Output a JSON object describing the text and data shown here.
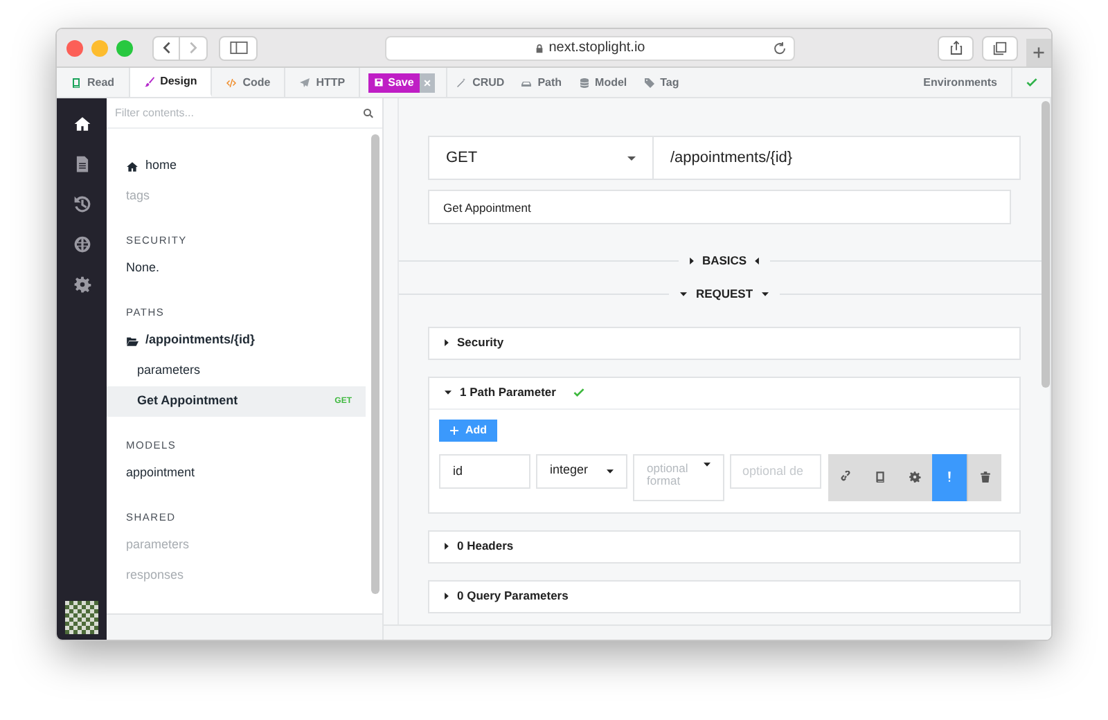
{
  "browser": {
    "url": "next.stoplight.io"
  },
  "toolbar": {
    "tabs": [
      {
        "label": "Read",
        "selected": false
      },
      {
        "label": "Design",
        "selected": true
      },
      {
        "label": "Code",
        "selected": false
      },
      {
        "label": "HTTP",
        "selected": false
      }
    ],
    "save": {
      "label": "Save",
      "close": "×"
    },
    "tools": [
      {
        "label": "CRUD"
      },
      {
        "label": "Path"
      },
      {
        "label": "Model"
      },
      {
        "label": "Tag"
      }
    ],
    "environments": "Environments"
  },
  "rail": [
    {
      "selected": true
    },
    {
      "selected": false
    },
    {
      "selected": false
    },
    {
      "selected": false
    },
    {
      "selected": false
    }
  ],
  "sidebar": {
    "filter": {
      "placeholder": "Filter contents..."
    },
    "sections": [
      {
        "items": [
          {
            "label": "home",
            "kind": "home",
            "muted": false,
            "selected": false
          },
          {
            "label": "tags",
            "muted": true,
            "selected": false
          }
        ]
      },
      {
        "heading": "SECURITY",
        "items": [
          {
            "label": "None.",
            "muted": false,
            "selected": false
          }
        ]
      },
      {
        "heading": "PATHS",
        "items": [
          {
            "label": "/appointments/{id}",
            "kind": "folder",
            "muted": false,
            "selected": false,
            "children": [
              {
                "label": "parameters",
                "muted": false,
                "selected": false
              },
              {
                "label": "Get Appointment",
                "badge": "GET",
                "muted": false,
                "selected": true
              }
            ]
          }
        ]
      },
      {
        "heading": "MODELS",
        "items": [
          {
            "label": "appointment",
            "muted": false,
            "selected": false
          }
        ]
      },
      {
        "heading": "SHARED",
        "items": [
          {
            "label": "parameters",
            "muted": true,
            "selected": false
          },
          {
            "label": "responses",
            "muted": true,
            "selected": false
          }
        ]
      }
    ]
  },
  "endpoint": {
    "method": "GET",
    "path": "/appointments/{id}",
    "summary": "Get Appointment"
  },
  "dividers": [
    {
      "label": "BASICS",
      "expanded": false
    },
    {
      "label": "REQUEST",
      "expanded": true
    }
  ],
  "panels": [
    {
      "title": "Security",
      "expanded": false,
      "valid": false
    },
    {
      "title": "1 Path Parameter",
      "expanded": true,
      "valid": true,
      "add": "Add",
      "params": [
        {
          "name": "id",
          "type": "integer",
          "format": {
            "placeholder": "optional format"
          },
          "description": {
            "placeholder": "optional de"
          },
          "actions": [
            {
              "on": false
            },
            {
              "on": false
            },
            {
              "on": false
            },
            {
              "on": true
            },
            {
              "on": false
            }
          ]
        }
      ]
    },
    {
      "title": "0 Headers",
      "expanded": false,
      "valid": false
    },
    {
      "title": "0 Query Parameters",
      "expanded": false,
      "valid": false
    }
  ]
}
